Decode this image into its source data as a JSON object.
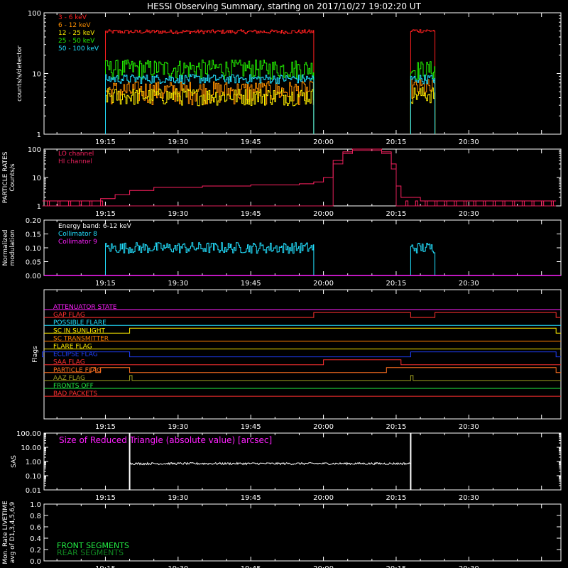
{
  "title": "HESSI Observing Summary, starting on 2017/10/27 19:02:20 UT",
  "x_tick_labels": [
    "19:15",
    "19:30",
    "19:45",
    "20:00",
    "20:15",
    "20:30"
  ],
  "colors": {
    "background": "#000000",
    "axes": "#ffffff",
    "band_3_6": "#ff2020",
    "band_6_12": "#ff9000",
    "band_12_25": "#ffee00",
    "band_25_50": "#22ee00",
    "band_50_100": "#22e0ff",
    "lo_channel": "#ff2060",
    "hi_channel": "#e0205a",
    "collimator_8": "#22e0ff",
    "collimator_9": "#ff20ff",
    "sas": "#ffffff",
    "sas_label": "#ff20ff",
    "front_segments": "#22ee44",
    "rear_segments": "#118822"
  },
  "chart_data": [
    {
      "type": "line",
      "ylabel": "counts/s/detector",
      "yscale": "log",
      "ylim": [
        1,
        100
      ],
      "y_tick_labels": [
        "1",
        "10",
        "100"
      ],
      "series": [
        {
          "name": "3 - 6 keV",
          "segments": [
            {
              "t0": "19:15",
              "t1": "19:58",
              "level": 50
            },
            {
              "t0": "20:18",
              "t1": "20:23",
              "level": 52
            }
          ]
        },
        {
          "name": "6 - 12 keV",
          "segments": [
            {
              "t0": "19:15",
              "t1": "19:58",
              "level": 5.5
            },
            {
              "t0": "20:18",
              "t1": "20:23",
              "level": 6
            }
          ]
        },
        {
          "name": "12 - 25 keV",
          "segments": [
            {
              "t0": "19:15",
              "t1": "19:58",
              "level": 4.2
            },
            {
              "t0": "20:18",
              "t1": "20:23",
              "level": 4.5
            }
          ]
        },
        {
          "name": "25 - 50 keV",
          "segments": [
            {
              "t0": "19:15",
              "t1": "19:58",
              "level": 10.5
            },
            {
              "t0": "20:18",
              "t1": "20:23",
              "level": 10
            }
          ]
        },
        {
          "name": "50 - 100 keV",
          "segments": [
            {
              "t0": "19:15",
              "t1": "19:58",
              "level": 8
            },
            {
              "t0": "20:18",
              "t1": "20:23",
              "level": 8
            }
          ]
        }
      ]
    },
    {
      "type": "line",
      "ylabel": "PARTICLE RATES Counts/s",
      "yscale": "log",
      "ylim": [
        1,
        100
      ],
      "y_tick_labels": [
        "1",
        "10",
        "100"
      ],
      "series": [
        {
          "name": "LO channel",
          "points": [
            [
              "19:02",
              1.5
            ],
            [
              "19:10",
              1.5
            ],
            [
              "19:14",
              1.8
            ],
            [
              "19:17",
              2.5
            ],
            [
              "19:20",
              3.5
            ],
            [
              "19:25",
              4.5
            ],
            [
              "19:35",
              5
            ],
            [
              "19:45",
              5.5
            ],
            [
              "19:55",
              6
            ],
            [
              "19:58",
              7
            ],
            [
              "20:00",
              10
            ],
            [
              "20:02",
              40
            ],
            [
              "20:04",
              80
            ],
            [
              "20:06",
              100
            ],
            [
              "20:10",
              100
            ],
            [
              "20:12",
              80
            ],
            [
              "20:14",
              30
            ],
            [
              "20:15",
              5
            ],
            [
              "20:16",
              2
            ],
            [
              "20:20",
              1.5
            ],
            [
              "20:48",
              1.5
            ]
          ]
        },
        {
          "name": "HI channel",
          "points": [
            [
              "19:02",
              1
            ],
            [
              "20:00",
              1
            ],
            [
              "20:02",
              30
            ],
            [
              "20:04",
              70
            ],
            [
              "20:06",
              90
            ],
            [
              "20:10",
              90
            ],
            [
              "20:12",
              70
            ],
            [
              "20:14",
              20
            ],
            [
              "20:15",
              1
            ],
            [
              "20:48",
              1
            ]
          ]
        }
      ]
    },
    {
      "type": "line",
      "ylabel": "Normalized modulation",
      "ylim": [
        0,
        0.2
      ],
      "y_tick_labels": [
        "0.00",
        "0.05",
        "0.10",
        "0.15",
        "0.20"
      ],
      "annotation": "Energy band: 6-12 keV",
      "series": [
        {
          "name": "Collimator 8",
          "segments": [
            {
              "t0": "19:15",
              "t1": "19:58",
              "level": 0.1
            },
            {
              "t0": "20:18",
              "t1": "20:23",
              "level": 0.1
            }
          ]
        },
        {
          "name": "Collimator 9",
          "points": [
            [
              "19:02",
              0
            ],
            [
              "20:48",
              0
            ]
          ]
        }
      ]
    },
    {
      "type": "line",
      "ylabel": "Flags",
      "flags": [
        {
          "name": "ATTENUATOR STATE",
          "color": "#ff20ff",
          "high": []
        },
        {
          "name": "GAP FLAG",
          "color": "#ff3030",
          "high": [
            [
              "19:58",
              "20:18"
            ],
            [
              "20:23",
              "20:48"
            ]
          ]
        },
        {
          "name": "POSSIBLE FLARE",
          "color": "#22e0ff",
          "high": []
        },
        {
          "name": "SC IN SUNLIGHT",
          "color": "#ffee00",
          "high": [
            [
              "19:20",
              "20:48"
            ]
          ]
        },
        {
          "name": "SC TRANSMITTER",
          "color": "#ff8000",
          "high": []
        },
        {
          "name": "FLARE FLAG",
          "color": "#ffee00",
          "high": []
        },
        {
          "name": "ECLIPSE FLAG",
          "color": "#2040ff",
          "high": [
            [
              "19:02",
              "19:20"
            ],
            [
              "20:18",
              "20:48"
            ]
          ]
        },
        {
          "name": "SAA FLAG",
          "color": "#ff3030",
          "high": [
            [
              "20:00",
              "20:16"
            ]
          ]
        },
        {
          "name": "PARTICLE FLAG",
          "color": "#ff7020",
          "high": [
            [
              "19:12",
              "19:13"
            ],
            [
              "19:14",
              "19:20"
            ],
            [
              "20:13",
              "20:48"
            ]
          ]
        },
        {
          "name": "AAZ FLAG",
          "color": "#a0a020",
          "high": [
            [
              "19:20",
              "19:20.5"
            ],
            [
              "20:18",
              "20:18.5"
            ]
          ]
        },
        {
          "name": "FRONTS OFF",
          "color": "#22ee44",
          "high": []
        },
        {
          "name": "BAD PACKETS",
          "color": "#ff3030",
          "high": []
        }
      ]
    },
    {
      "type": "line",
      "ylabel": "SAS",
      "yscale": "log",
      "ylim": [
        0.01,
        100
      ],
      "y_tick_labels": [
        "100.00",
        "10.00",
        "1.00",
        "0.10",
        "0.01"
      ],
      "annotation": "Size of Reduced Triangle (absolute value) [arcsec]",
      "series": [
        {
          "name": "SAS",
          "points": [
            [
              "19:20",
              0.7
            ],
            [
              "20:18",
              0.7
            ]
          ],
          "spikes": [
            "19:20",
            "20:18"
          ]
        }
      ]
    },
    {
      "type": "line",
      "ylabel": "Mon. Rate LIVETIME avg of D1,3,4,5,6,9",
      "ylim": [
        0,
        1
      ],
      "y_tick_labels": [
        "0.0",
        "0.2",
        "0.4",
        "0.6",
        "0.8",
        "1.0"
      ],
      "series": [
        {
          "name": "FRONT SEGMENTS",
          "points": []
        },
        {
          "name": "REAR SEGMENTS",
          "points": []
        }
      ]
    }
  ]
}
